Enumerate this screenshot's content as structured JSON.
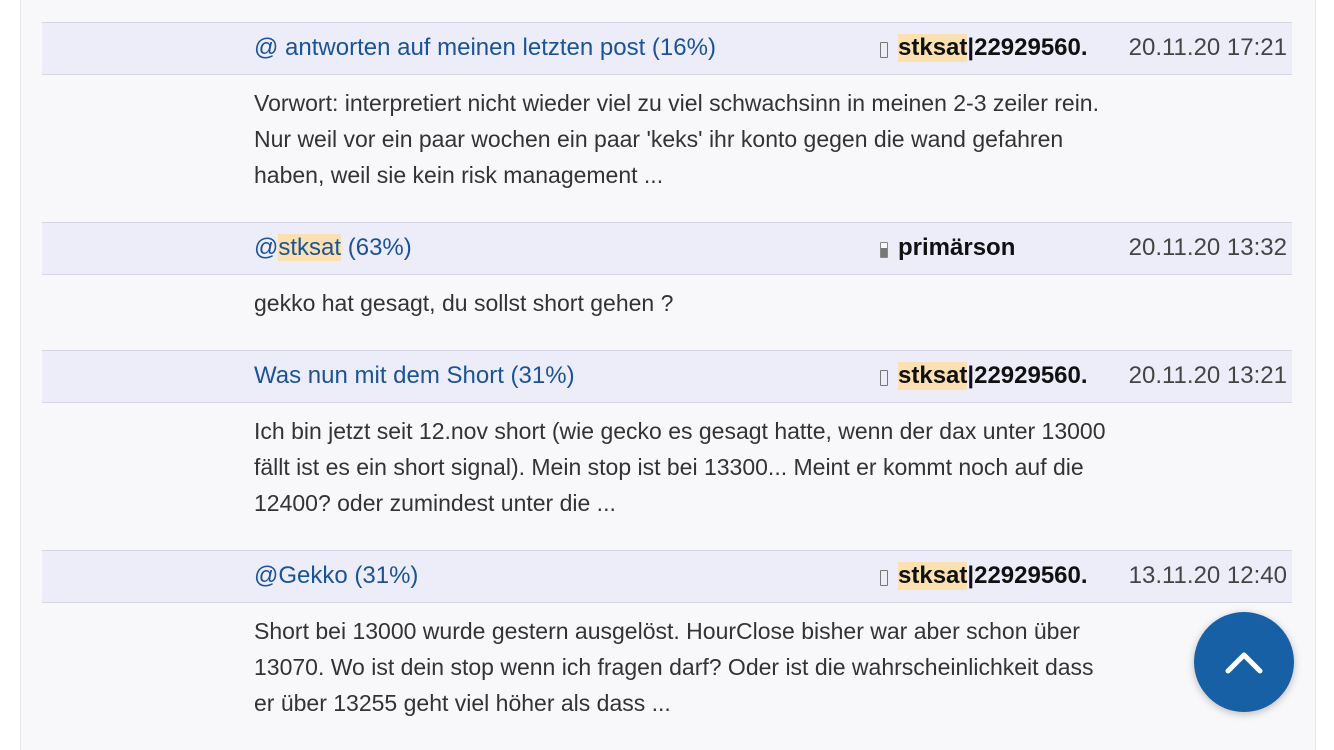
{
  "posts": [
    {
      "title_prefix": "",
      "title_mention": "",
      "title_rest": "@ antworten auf meinen letzten post (16%)",
      "author_highlight": "stksat",
      "author_rest": "|22929560.",
      "author_status": "offline",
      "date": "20.11.20 17:21",
      "body": "Vorwort: interpretiert nicht wieder viel zu viel schwachsinn in meinen 2-3 zeiler rein. Nur weil vor ein paar wochen ein paar 'keks' ihr konto gegen die wand gefahren haben, weil sie kein risk management ..."
    },
    {
      "title_prefix": "@",
      "title_mention": "stksat",
      "title_rest": " (63%)",
      "author_highlight": "",
      "author_rest": "primärson",
      "author_status": "online",
      "date": "20.11.20 13:32",
      "body": "gekko hat gesagt, du sollst short gehen ?"
    },
    {
      "title_prefix": "",
      "title_mention": "",
      "title_rest": "Was nun mit dem Short (31%)",
      "author_highlight": "stksat",
      "author_rest": "|22929560.",
      "author_status": "offline",
      "date": "20.11.20 13:21",
      "body": "Ich bin jetzt seit 12.nov short (wie gecko es gesagt hatte, wenn der dax unter 13000 fällt ist es ein short signal). Mein stop ist bei 13300... Meint er kommt noch auf die 12400? oder zumindest unter die ..."
    },
    {
      "title_prefix": "",
      "title_mention": "",
      "title_rest": "@Gekko (31%)",
      "author_highlight": "stksat",
      "author_rest": "|22929560.",
      "author_status": "offline",
      "date": "13.11.20 12:40",
      "body": "Short bei 13000 wurde gestern ausgelöst. HourClose bisher war aber schon über 13070. Wo ist dein stop wenn ich fragen darf? Oder ist die wahrscheinlichkeit dass er über 13255 geht viel höher als dass ..."
    }
  ],
  "scroll_top": {
    "icon": "chevron-up-icon",
    "color": "#1860a6"
  },
  "colors": {
    "link": "#1a5396",
    "highlight": "#fbe1b1",
    "header_bg": "#ededfa"
  }
}
